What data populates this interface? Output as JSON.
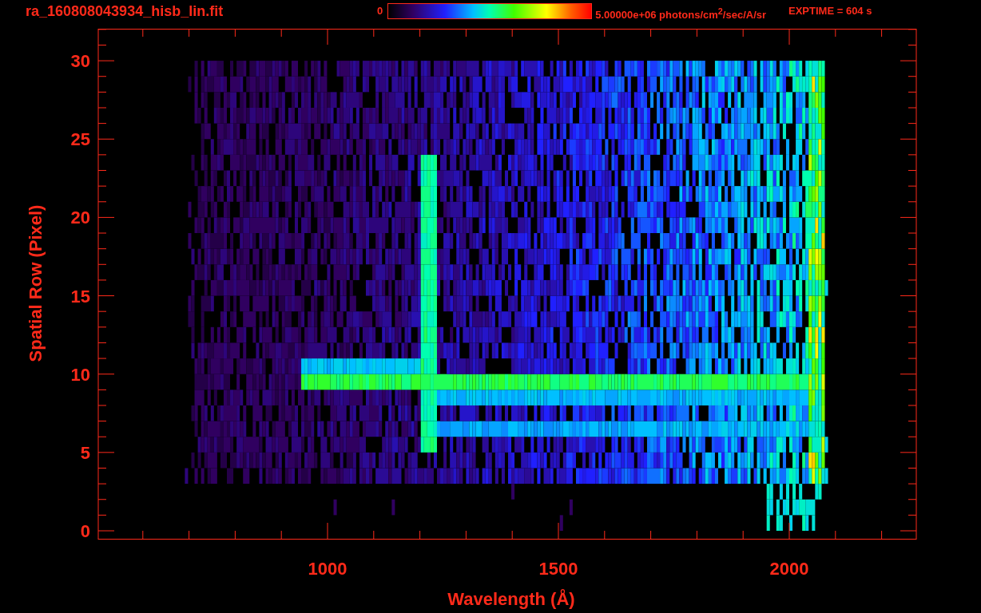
{
  "title": "ra_160808043934_hisb_lin.fit",
  "colorbar": {
    "min_label": "0",
    "max_label": "5.00000e+06 photons/cm$^{2}$/sec/A/sr"
  },
  "exptime": "EXPTIME = 604 s",
  "plot": {
    "xlabel": "Wavelength (Å)",
    "ylabel": "Spatial Row (Pixel)",
    "xticks": [
      "1000",
      "1500",
      "2000"
    ],
    "yticks": [
      "30",
      "25",
      "20",
      "15",
      "10",
      "5",
      "0"
    ]
  }
}
